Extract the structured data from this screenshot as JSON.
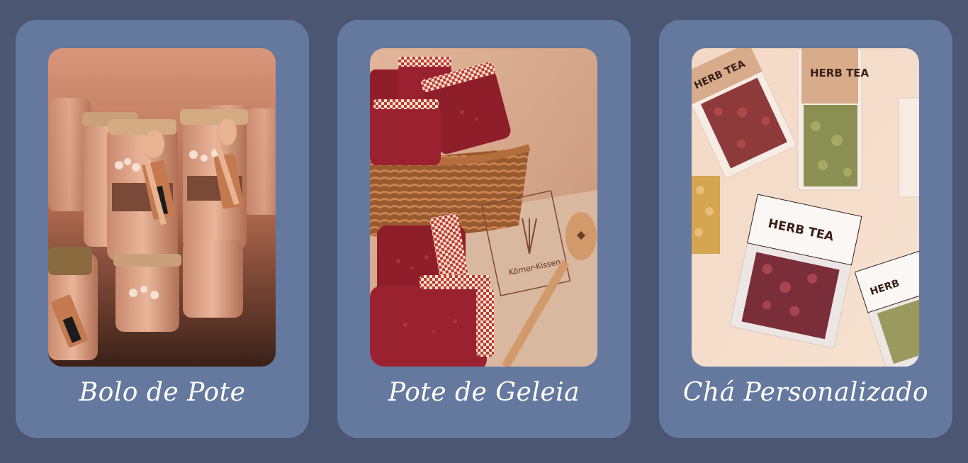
{
  "colors": {
    "page_background": "#4a5672",
    "card_background": "#65799f",
    "caption_text": "#ffffff"
  },
  "cards": [
    {
      "title": "Bolo de Pote",
      "image": "cake-in-jar-photo"
    },
    {
      "title": "Pote de Geleia",
      "image": "jam-jars-basket-photo",
      "bag_text": "Körner-Kissen"
    },
    {
      "title": "Chá Personalizado",
      "image": "herb-tea-packets-photo",
      "packet_labels": [
        "HERB TEA",
        "HERB TEA",
        "HERB TEA",
        "HERB"
      ]
    }
  ]
}
